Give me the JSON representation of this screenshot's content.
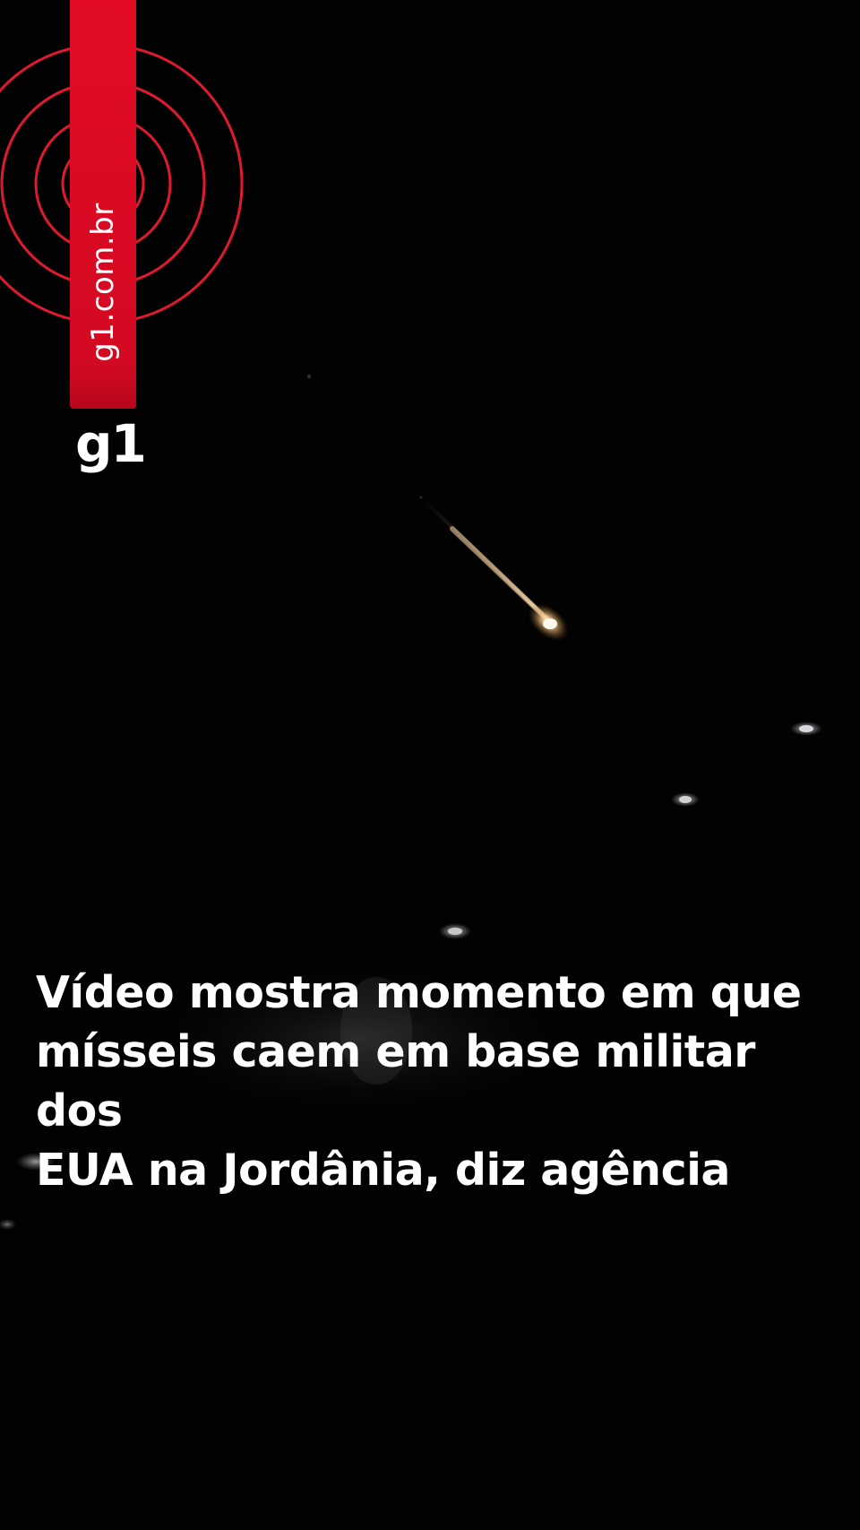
{
  "brand": {
    "url": "g1.com.br",
    "logo": "g1",
    "colors": {
      "accent": "#e30b24",
      "ring": "#e01a2e"
    }
  },
  "headline": {
    "line1": "Vídeo mostra momento em que",
    "line2": "mísseis caem em base militar dos",
    "line3": "EUA na Jordânia, diz agência"
  },
  "scene": {
    "description_icon": "missile-streak-night-sky"
  }
}
